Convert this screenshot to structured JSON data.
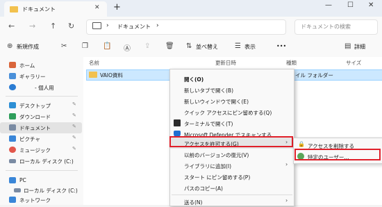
{
  "window": {
    "tab_title": "ドキュメント",
    "new_tab": "+",
    "close_tab": "✕",
    "minimize": "—",
    "maximize": "☐",
    "close": "✕"
  },
  "address": {
    "pc_label": "›",
    "path": "ドキュメント",
    "chevron": "›",
    "search_placeholder": "ドキュメントの検索"
  },
  "toolbar": {
    "new_label": "新規作成",
    "sort_label": "並べ替え",
    "view_label": "表示",
    "more": "•••",
    "details_label": "詳細"
  },
  "sidebar": {
    "items": [
      {
        "label": "ホーム",
        "icon": "home-icon",
        "color": "#d9653b"
      },
      {
        "label": "ギャラリー",
        "icon": "gallery-icon",
        "color": "#4a90d9"
      },
      {
        "label": "- 個人用",
        "icon": "onedrive-icon",
        "color": "#2b7cd3"
      },
      {
        "label": "デスクトップ",
        "icon": "desktop-icon",
        "color": "#2d8fd5",
        "pin": "📌"
      },
      {
        "label": "ダウンロード",
        "icon": "download-icon",
        "color": "#2e9e5b",
        "pin": "📌"
      },
      {
        "label": "ドキュメント",
        "icon": "documents-icon",
        "color": "#7a8ba3",
        "pin": "📌"
      },
      {
        "label": "ピクチャ",
        "icon": "pictures-icon",
        "color": "#3a86d8",
        "pin": "📌"
      },
      {
        "label": "ミュージック",
        "icon": "music-icon",
        "color": "#e2574c",
        "pin": "📌"
      },
      {
        "label": "ローカル ディスク (C:)",
        "icon": "drive-icon",
        "color": "#7a8ba3",
        "pin": "📌"
      },
      {
        "label": "PC",
        "icon": "pc-icon",
        "color": "#3a86d8"
      },
      {
        "label": "ローカル ディスク (C:)",
        "icon": "drive-icon",
        "color": "#7a8ba3"
      },
      {
        "label": "ネットワーク",
        "icon": "network-icon",
        "color": "#3a86d8"
      }
    ]
  },
  "columns": {
    "name": "名前",
    "modified": "更新日時",
    "type": "種類",
    "size": "サイズ"
  },
  "files": [
    {
      "name": "VAIO資料",
      "type": "イル フォルダー"
    }
  ],
  "context_menu": {
    "items": [
      {
        "label": "開く(O)"
      },
      {
        "label": "新しいタブで開く(B)"
      },
      {
        "label": "新しいウィンドウで開く(E)"
      },
      {
        "label": "クイック アクセスにピン留めする(Q)"
      },
      {
        "label": "ターミナルで開く(T)",
        "icon": "terminal-icon"
      },
      {
        "label": "Microsoft Defender でスキャンする...",
        "icon": "defender-icon"
      },
      {
        "label": "アクセスを許可する(G)",
        "submenu": true
      },
      {
        "label": "以前のバージョンの復元(V)"
      },
      {
        "label": "ライブラリに追加(I)",
        "submenu": true
      },
      {
        "label": "スタート にピン留めする(P)"
      },
      {
        "label": "パスのコピー(A)"
      },
      {
        "label": "送る(N)",
        "submenu": true
      }
    ]
  },
  "submenu": {
    "items": [
      {
        "label": "アクセスを削除する",
        "icon": "lock-icon"
      },
      {
        "label": "特定のユーザー...",
        "icon": "users-icon"
      }
    ]
  },
  "colors": {
    "highlight_border": "#e0202a",
    "selection": "#cce8ff"
  }
}
